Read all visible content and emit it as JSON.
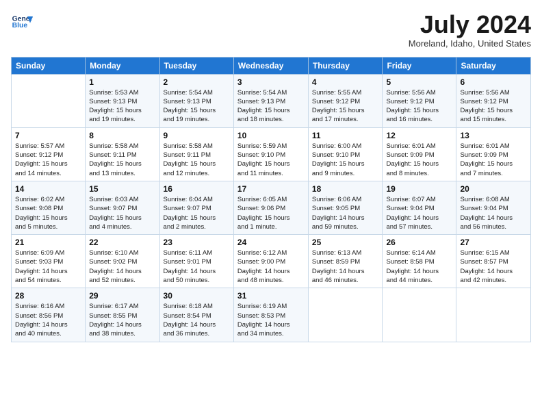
{
  "header": {
    "logo_line1": "General",
    "logo_line2": "Blue",
    "month_year": "July 2024",
    "location": "Moreland, Idaho, United States"
  },
  "days_of_week": [
    "Sunday",
    "Monday",
    "Tuesday",
    "Wednesday",
    "Thursday",
    "Friday",
    "Saturday"
  ],
  "weeks": [
    [
      {
        "num": "",
        "info": ""
      },
      {
        "num": "1",
        "info": "Sunrise: 5:53 AM\nSunset: 9:13 PM\nDaylight: 15 hours\nand 19 minutes."
      },
      {
        "num": "2",
        "info": "Sunrise: 5:54 AM\nSunset: 9:13 PM\nDaylight: 15 hours\nand 19 minutes."
      },
      {
        "num": "3",
        "info": "Sunrise: 5:54 AM\nSunset: 9:13 PM\nDaylight: 15 hours\nand 18 minutes."
      },
      {
        "num": "4",
        "info": "Sunrise: 5:55 AM\nSunset: 9:12 PM\nDaylight: 15 hours\nand 17 minutes."
      },
      {
        "num": "5",
        "info": "Sunrise: 5:56 AM\nSunset: 9:12 PM\nDaylight: 15 hours\nand 16 minutes."
      },
      {
        "num": "6",
        "info": "Sunrise: 5:56 AM\nSunset: 9:12 PM\nDaylight: 15 hours\nand 15 minutes."
      }
    ],
    [
      {
        "num": "7",
        "info": "Sunrise: 5:57 AM\nSunset: 9:12 PM\nDaylight: 15 hours\nand 14 minutes."
      },
      {
        "num": "8",
        "info": "Sunrise: 5:58 AM\nSunset: 9:11 PM\nDaylight: 15 hours\nand 13 minutes."
      },
      {
        "num": "9",
        "info": "Sunrise: 5:58 AM\nSunset: 9:11 PM\nDaylight: 15 hours\nand 12 minutes."
      },
      {
        "num": "10",
        "info": "Sunrise: 5:59 AM\nSunset: 9:10 PM\nDaylight: 15 hours\nand 11 minutes."
      },
      {
        "num": "11",
        "info": "Sunrise: 6:00 AM\nSunset: 9:10 PM\nDaylight: 15 hours\nand 9 minutes."
      },
      {
        "num": "12",
        "info": "Sunrise: 6:01 AM\nSunset: 9:09 PM\nDaylight: 15 hours\nand 8 minutes."
      },
      {
        "num": "13",
        "info": "Sunrise: 6:01 AM\nSunset: 9:09 PM\nDaylight: 15 hours\nand 7 minutes."
      }
    ],
    [
      {
        "num": "14",
        "info": "Sunrise: 6:02 AM\nSunset: 9:08 PM\nDaylight: 15 hours\nand 5 minutes."
      },
      {
        "num": "15",
        "info": "Sunrise: 6:03 AM\nSunset: 9:07 PM\nDaylight: 15 hours\nand 4 minutes."
      },
      {
        "num": "16",
        "info": "Sunrise: 6:04 AM\nSunset: 9:07 PM\nDaylight: 15 hours\nand 2 minutes."
      },
      {
        "num": "17",
        "info": "Sunrise: 6:05 AM\nSunset: 9:06 PM\nDaylight: 15 hours\nand 1 minute."
      },
      {
        "num": "18",
        "info": "Sunrise: 6:06 AM\nSunset: 9:05 PM\nDaylight: 14 hours\nand 59 minutes."
      },
      {
        "num": "19",
        "info": "Sunrise: 6:07 AM\nSunset: 9:04 PM\nDaylight: 14 hours\nand 57 minutes."
      },
      {
        "num": "20",
        "info": "Sunrise: 6:08 AM\nSunset: 9:04 PM\nDaylight: 14 hours\nand 56 minutes."
      }
    ],
    [
      {
        "num": "21",
        "info": "Sunrise: 6:09 AM\nSunset: 9:03 PM\nDaylight: 14 hours\nand 54 minutes."
      },
      {
        "num": "22",
        "info": "Sunrise: 6:10 AM\nSunset: 9:02 PM\nDaylight: 14 hours\nand 52 minutes."
      },
      {
        "num": "23",
        "info": "Sunrise: 6:11 AM\nSunset: 9:01 PM\nDaylight: 14 hours\nand 50 minutes."
      },
      {
        "num": "24",
        "info": "Sunrise: 6:12 AM\nSunset: 9:00 PM\nDaylight: 14 hours\nand 48 minutes."
      },
      {
        "num": "25",
        "info": "Sunrise: 6:13 AM\nSunset: 8:59 PM\nDaylight: 14 hours\nand 46 minutes."
      },
      {
        "num": "26",
        "info": "Sunrise: 6:14 AM\nSunset: 8:58 PM\nDaylight: 14 hours\nand 44 minutes."
      },
      {
        "num": "27",
        "info": "Sunrise: 6:15 AM\nSunset: 8:57 PM\nDaylight: 14 hours\nand 42 minutes."
      }
    ],
    [
      {
        "num": "28",
        "info": "Sunrise: 6:16 AM\nSunset: 8:56 PM\nDaylight: 14 hours\nand 40 minutes."
      },
      {
        "num": "29",
        "info": "Sunrise: 6:17 AM\nSunset: 8:55 PM\nDaylight: 14 hours\nand 38 minutes."
      },
      {
        "num": "30",
        "info": "Sunrise: 6:18 AM\nSunset: 8:54 PM\nDaylight: 14 hours\nand 36 minutes."
      },
      {
        "num": "31",
        "info": "Sunrise: 6:19 AM\nSunset: 8:53 PM\nDaylight: 14 hours\nand 34 minutes."
      },
      {
        "num": "",
        "info": ""
      },
      {
        "num": "",
        "info": ""
      },
      {
        "num": "",
        "info": ""
      }
    ]
  ]
}
